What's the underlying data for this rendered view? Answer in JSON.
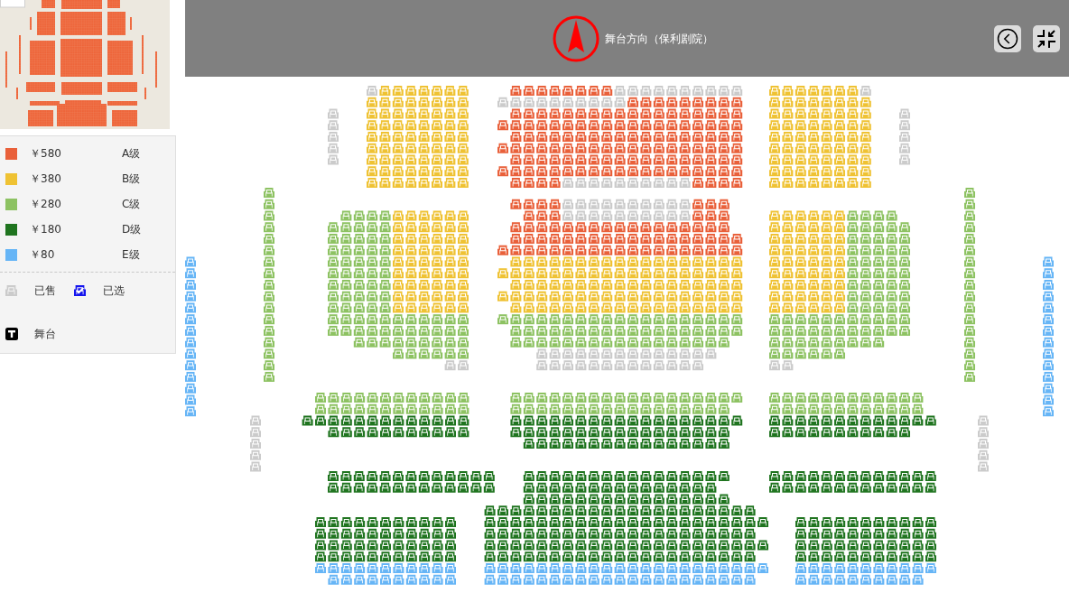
{
  "header": {
    "title": "舞台方向（保利剧院）"
  },
  "legend": {
    "prices": [
      {
        "price": "￥580",
        "tier": "A级",
        "color": "#e9603a"
      },
      {
        "price": "￥380",
        "tier": "B级",
        "color": "#efc233"
      },
      {
        "price": "￥280",
        "tier": "C级",
        "color": "#8dc262"
      },
      {
        "price": "￥180",
        "tier": "D级",
        "color": "#1f741f"
      },
      {
        "price": "￥80",
        "tier": "E级",
        "color": "#66b5f6"
      }
    ],
    "statuses": [
      {
        "kind": "sold",
        "label": "已售"
      },
      {
        "kind": "selected",
        "label": "已选"
      }
    ],
    "stage": {
      "label": "舞台"
    }
  }
}
